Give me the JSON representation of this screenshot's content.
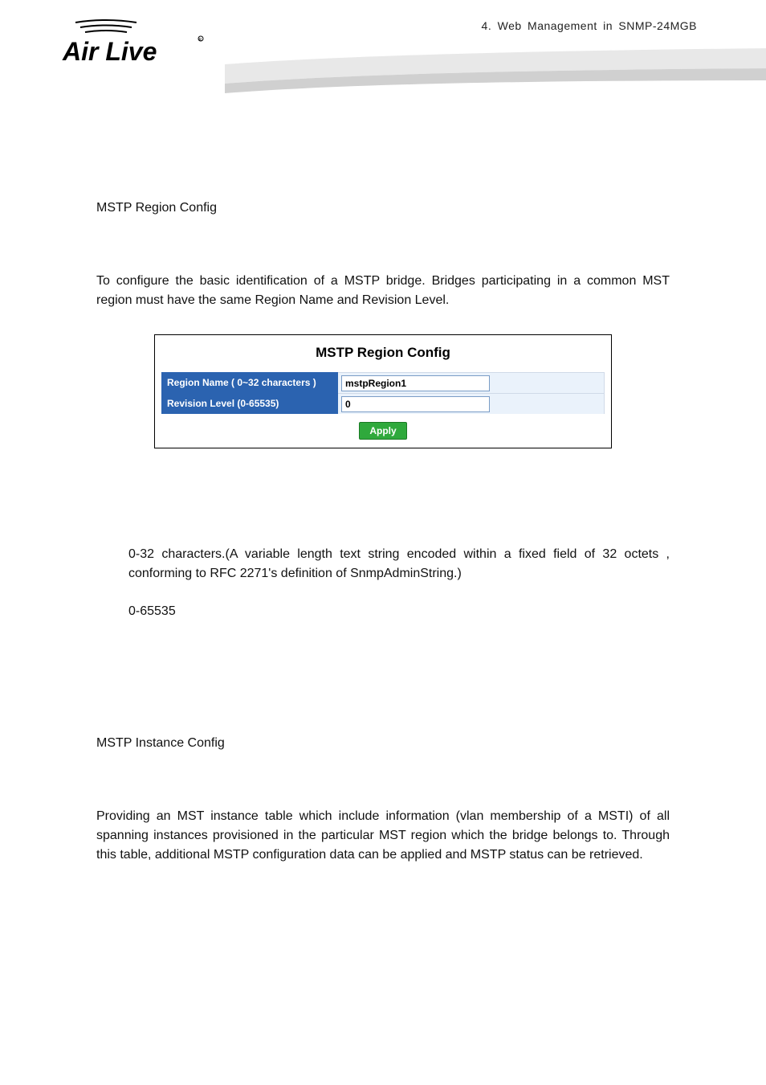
{
  "header": {
    "chapter": "4.   Web  Management  in  SNMP-24MGB",
    "logo_brand": "Air Live"
  },
  "section1": {
    "title": "MSTP Region Config",
    "intro": "To configure the basic identification of a MSTP bridge. Bridges participating in a common MST region must have the same Region Name and Revision Level."
  },
  "config_panel": {
    "title": "MSTP Region Config",
    "rows": [
      {
        "label": "Region Name ( 0~32 characters )",
        "value": "mstpRegion1"
      },
      {
        "label": "Revision Level (0-65535)",
        "value": "0"
      }
    ],
    "apply_label": "Apply"
  },
  "param_desc": {
    "region_name": "0-32 characters.(A variable length text string encoded within a fixed field of 32 octets , conforming to RFC 2271's definition of SnmpAdminString.)",
    "revision_level": "0-65535"
  },
  "section2": {
    "title": "MSTP Instance Config",
    "intro": "Providing an MST instance table which include information (vlan membership of a MSTI) of all spanning instances provisioned in the particular MST region which the bridge belongs to. Through this table, additional MSTP configuration data can be applied and MSTP status can be retrieved."
  }
}
